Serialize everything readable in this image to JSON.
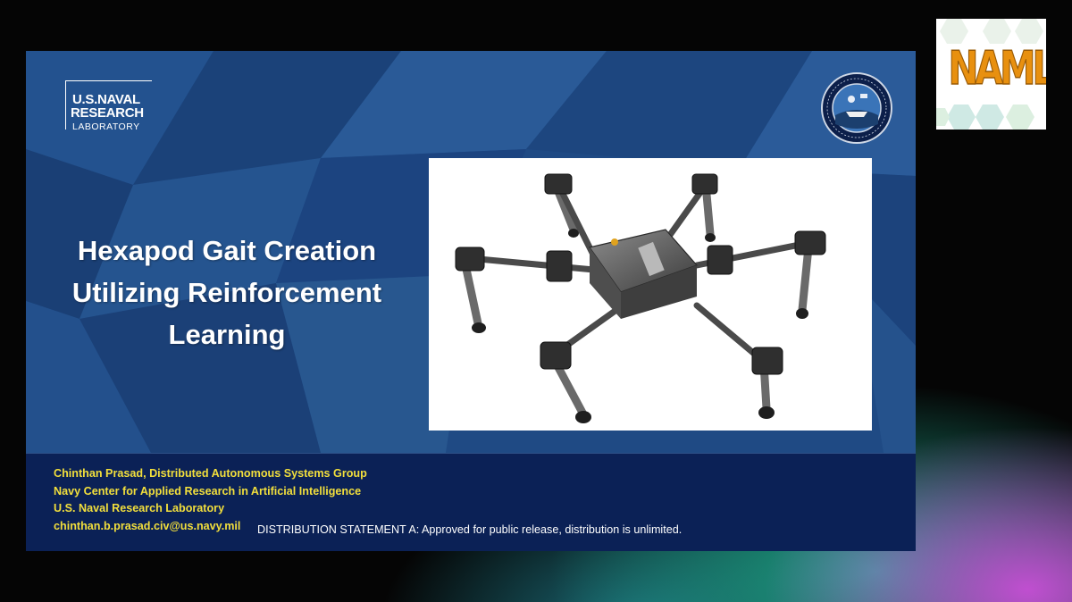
{
  "slide": {
    "logo": {
      "line1": "U.S.NAVAL",
      "line2": "RESEARCH",
      "line3": "LABORATORY"
    },
    "title_lines": [
      "Hexapod Gait Creation",
      "Utilizing Reinforcement",
      "Learning"
    ],
    "footer": {
      "credits": [
        "Chinthan Prasad, Distributed Autonomous Systems Group",
        "Navy Center for Applied Research in Artificial Intelligence",
        "U.S. Naval Research Laboratory",
        "chinthan.b.prasad.civ@us.navy.mil"
      ],
      "statement": "DISTRIBUTION STATEMENT A:  Approved for public release, distribution is unlimited."
    }
  },
  "naml_badge": {
    "text": "NAML"
  },
  "colors": {
    "slide_blue": "#1f4a84",
    "footer_navy": "#0b2156",
    "credit_yellow": "#f2df3c",
    "naml_orange": "#e8900f"
  },
  "icons": [
    "nrl-logo",
    "lab-seal-icon",
    "hexapod-robot-image",
    "naml-logo"
  ]
}
